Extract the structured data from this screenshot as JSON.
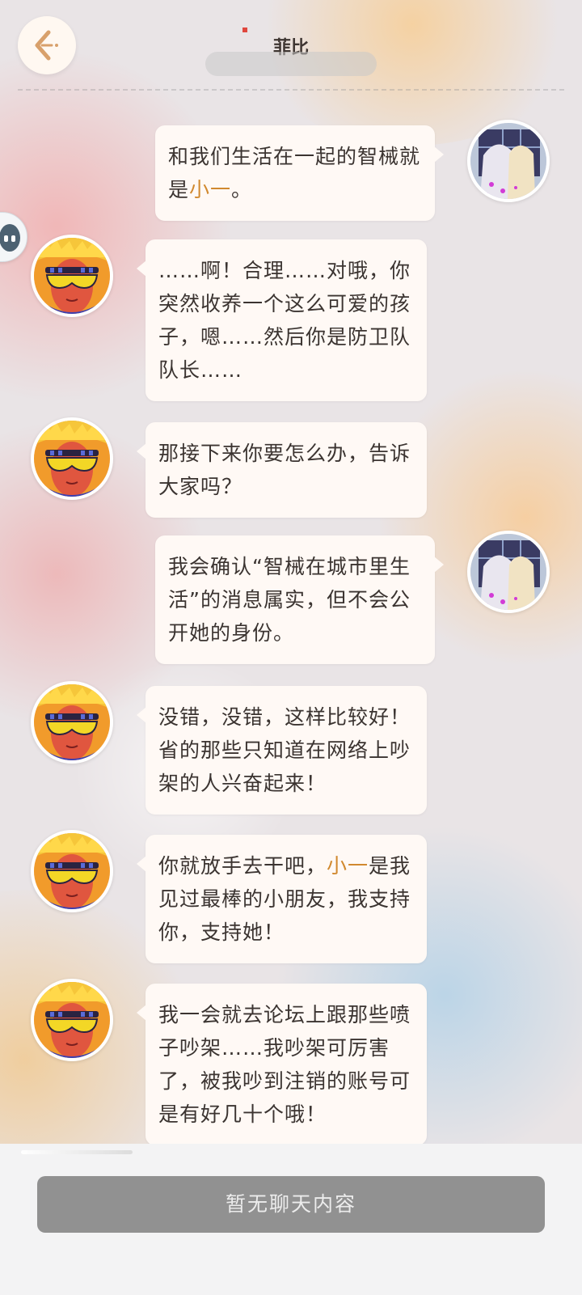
{
  "header": {
    "title": "菲比",
    "status": "",
    "notification": ""
  },
  "messages": [
    {
      "side": "right",
      "avatar": "phoebe-avatar",
      "parts": [
        {
          "t": "和我们生活在一起的智械"
        },
        {
          "t": "就是"
        },
        {
          "t": "小一",
          "hl": true
        },
        {
          "t": "。"
        }
      ]
    },
    {
      "side": "left",
      "avatar": "masked-girl-avatar",
      "parts": [
        {
          "t": "……啊！合理……对哦，你突然收养一个这么可爱的孩子，嗯……然后你是防卫队队长……"
        }
      ]
    },
    {
      "side": "left",
      "avatar": "masked-girl-avatar",
      "parts": [
        {
          "t": "那接下来你要怎么办，告诉大家吗？"
        }
      ]
    },
    {
      "side": "right",
      "avatar": "phoebe-avatar",
      "parts": [
        {
          "t": "我会确认“智械在城市里生活”的消息属实，但不会公开她的身份。"
        }
      ]
    },
    {
      "side": "left",
      "avatar": "masked-girl-avatar",
      "parts": [
        {
          "t": "没错，没错，这样比较好！省的那些只知道在网络上吵架的人兴奋起来！"
        }
      ]
    },
    {
      "side": "left",
      "avatar": "masked-girl-avatar",
      "parts": [
        {
          "t": "你就放手去干吧，"
        },
        {
          "t": "小一",
          "hl": true
        },
        {
          "t": "是我见过最棒的小朋友，我支持你，支持她！"
        }
      ]
    },
    {
      "side": "left",
      "avatar": "masked-girl-avatar",
      "parts": [
        {
          "t": "我一会就去论坛上跟那些喷子吵架……我吵架可厉害了，被我吵到注销的账号可是有好几十个哦！"
        }
      ]
    }
  ],
  "footer": {
    "no_chat_label": "暂无聊天内容"
  },
  "colors": {
    "highlight": "#d1892f",
    "bubble": "#fff9f5",
    "footer_button": "#919191"
  },
  "icons": {
    "back": "back-arrow-icon",
    "side_float": "assistant-bot-icon"
  }
}
